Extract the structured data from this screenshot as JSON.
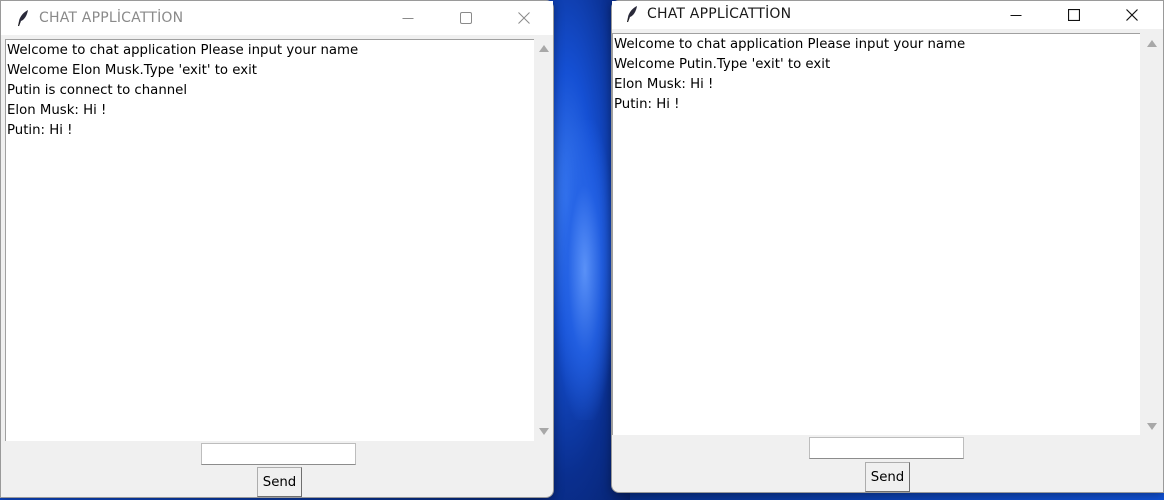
{
  "left_window": {
    "title": "CHAT APPLİCATTİON",
    "messages": [
      "Welcome to chat application Please input your name",
      "Welcome Elon Musk.Type 'exit' to exit",
      "Putin is connect to channel",
      "Elon Musk: Hi !",
      "Putin: Hi !"
    ],
    "input_value": "",
    "send_label": "Send"
  },
  "right_window": {
    "title": "CHAT APPLİCATTİON",
    "messages": [
      "Welcome to chat application Please input your name",
      "Welcome Putin.Type 'exit' to exit",
      "Elon Musk: Hi !",
      "Putin: Hi !"
    ],
    "input_value": "",
    "send_label": "Send"
  },
  "icons": {
    "app": "feather-icon",
    "minimize": "minimize-icon",
    "maximize": "maximize-icon",
    "close": "close-icon"
  },
  "colors": {
    "wallpaper": "#0b3fb5",
    "window_bg": "#f0f0f0",
    "chat_bg": "#ffffff",
    "inactive_title": "#8a8a8a",
    "active_title": "#1a1a1a"
  }
}
